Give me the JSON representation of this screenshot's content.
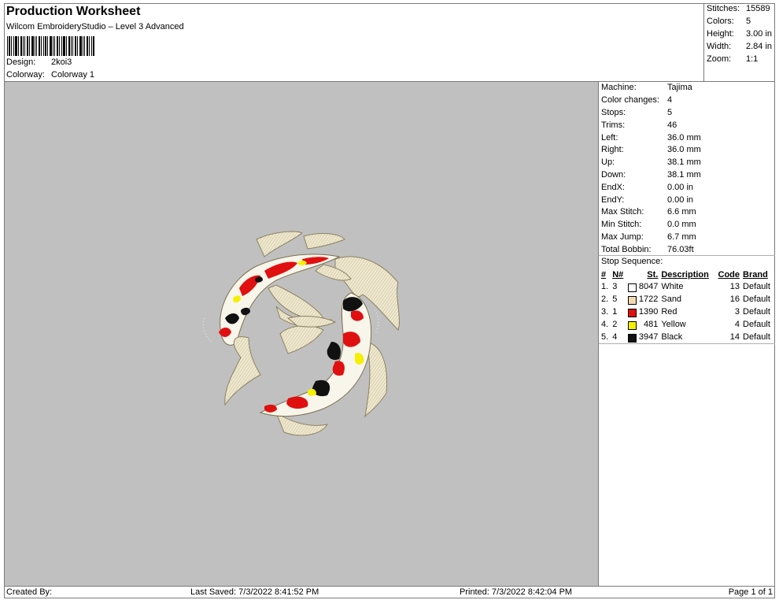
{
  "header": {
    "title": "Production Worksheet",
    "subtitle": "Wilcom EmbroideryStudio – Level 3 Advanced",
    "design_label": "Design:",
    "design_value": "2koi3",
    "colorway_label": "Colorway:",
    "colorway_value": "Colorway 1"
  },
  "summary": [
    {
      "label": "Stitches:",
      "value": "15589"
    },
    {
      "label": "Colors:",
      "value": "5"
    },
    {
      "label": "Height:",
      "value": "3.00 in"
    },
    {
      "label": "Width:",
      "value": "2.84 in"
    },
    {
      "label": "Zoom:",
      "value": "1:1"
    }
  ],
  "machine_info": [
    {
      "label": "Machine:",
      "value": "Tajima"
    },
    {
      "label": "Color changes:",
      "value": "4"
    },
    {
      "label": "Stops:",
      "value": "5"
    },
    {
      "label": "Trims:",
      "value": "46"
    },
    {
      "label": "Left:",
      "value": "36.0 mm"
    },
    {
      "label": "Right:",
      "value": "36.0 mm"
    },
    {
      "label": "Up:",
      "value": "38.1 mm"
    },
    {
      "label": "Down:",
      "value": "38.1 mm"
    },
    {
      "label": "EndX:",
      "value": "0.00 in"
    },
    {
      "label": "EndY:",
      "value": "0.00 in"
    },
    {
      "label": "Max Stitch:",
      "value": "6.6 mm"
    },
    {
      "label": "Min Stitch:",
      "value": "0.0 mm"
    },
    {
      "label": "Max Jump:",
      "value": "6.7 mm"
    },
    {
      "label": "Total Bobbin:",
      "value": "76.03ft"
    }
  ],
  "stop_sequence": {
    "title": "Stop Sequence:",
    "headers": {
      "num": "#",
      "needle": "N#",
      "stitches": "St.",
      "description": "Description",
      "code": "Code",
      "brand": "Brand"
    },
    "rows": [
      {
        "num": "1.",
        "needle": "3",
        "color": "#ffffff",
        "stitches": "8047",
        "description": "White",
        "code": "13",
        "brand": "Default"
      },
      {
        "num": "2.",
        "needle": "5",
        "color": "#f4d9b5",
        "stitches": "1722",
        "description": "Sand",
        "code": "16",
        "brand": "Default"
      },
      {
        "num": "3.",
        "needle": "1",
        "color": "#e01010",
        "stitches": "1390",
        "description": "Red",
        "code": "3",
        "brand": "Default"
      },
      {
        "num": "4.",
        "needle": "2",
        "color": "#f5f000",
        "stitches": "481",
        "description": "Yellow",
        "code": "4",
        "brand": "Default"
      },
      {
        "num": "5.",
        "needle": "4",
        "color": "#111111",
        "stitches": "3947",
        "description": "Black",
        "code": "14",
        "brand": "Default"
      }
    ]
  },
  "footer": {
    "created_by": "Created By:",
    "last_saved": "Last Saved: 7/3/2022 8:41:52 PM",
    "printed": "Printed: 7/3/2022 8:42:04 PM",
    "page": "Page 1 of 1"
  },
  "colors": {
    "canvas_bg": "#c0c0c0",
    "fin": "#efe8cf",
    "body": "#f8f5ea",
    "red": "#e01010",
    "yellow": "#f5f000",
    "black": "#111111"
  }
}
